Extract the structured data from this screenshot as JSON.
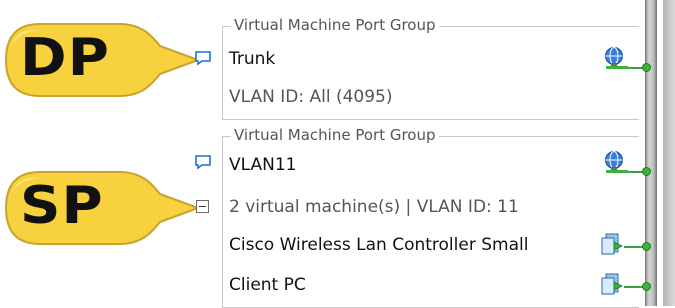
{
  "callouts": {
    "dp": {
      "label": "DP",
      "color": "#f7d23e"
    },
    "sp": {
      "label": "SP",
      "color": "#f7d23e"
    }
  },
  "port_groups": [
    {
      "legend": "Virtual Machine Port Group",
      "name": "Trunk",
      "detail": "VLAN ID: All (4095)"
    },
    {
      "legend": "Virtual Machine Port Group",
      "name": "VLAN11",
      "detail": "2 virtual machine(s) | VLAN ID: 11",
      "vms": [
        {
          "name": "Cisco Wireless Lan Controller Small"
        },
        {
          "name": "Client PC"
        }
      ]
    }
  ],
  "colors": {
    "link_green": "#3db33d",
    "callout_yellow": "#f7d23e",
    "icon_blue": "#1f6fd1"
  },
  "icons": {
    "port_group": "speech-bubble-icon",
    "collapse": "collapse-minus-icon",
    "network_adapter": "network-globe-icon",
    "vm": "virtual-machine-icon"
  }
}
